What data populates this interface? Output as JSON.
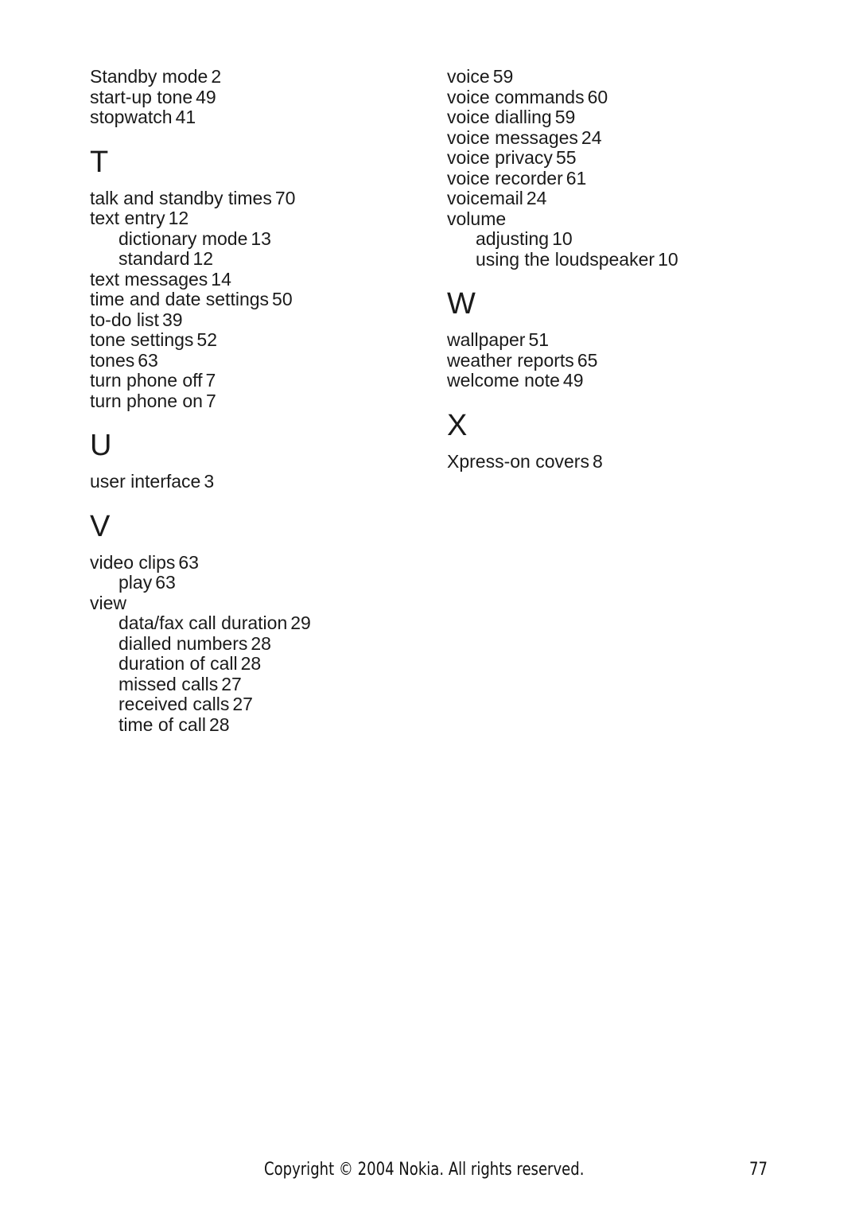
{
  "left_column": {
    "sections": [
      {
        "letter": "",
        "entries": [
          {
            "term": "Standby mode",
            "page": "2",
            "sub": false
          },
          {
            "term": "start-up tone",
            "page": "49",
            "sub": false
          },
          {
            "term": "stopwatch",
            "page": "41",
            "sub": false
          }
        ]
      },
      {
        "letter": "T",
        "entries": [
          {
            "term": "talk and standby times",
            "page": "70",
            "sub": false
          },
          {
            "term": "text entry",
            "page": "12",
            "sub": false
          },
          {
            "term": "dictionary mode",
            "page": "13",
            "sub": true
          },
          {
            "term": "standard",
            "page": "12",
            "sub": true
          },
          {
            "term": "text messages",
            "page": "14",
            "sub": false
          },
          {
            "term": "time and date settings",
            "page": "50",
            "sub": false
          },
          {
            "term": "to-do list",
            "page": "39",
            "sub": false
          },
          {
            "term": "tone settings",
            "page": "52",
            "sub": false
          },
          {
            "term": "tones",
            "page": "63",
            "sub": false
          },
          {
            "term": "turn phone off",
            "page": "7",
            "sub": false
          },
          {
            "term": "turn phone on",
            "page": "7",
            "sub": false
          }
        ]
      },
      {
        "letter": "U",
        "entries": [
          {
            "term": "user interface",
            "page": "3",
            "sub": false
          }
        ]
      },
      {
        "letter": "V",
        "entries": [
          {
            "term": "video clips",
            "page": "63",
            "sub": false
          },
          {
            "term": "play",
            "page": "63",
            "sub": true
          },
          {
            "term": "view",
            "page": "",
            "sub": false
          },
          {
            "term": "data/fax call duration",
            "page": "29",
            "sub": true
          },
          {
            "term": "dialled numbers",
            "page": "28",
            "sub": true
          },
          {
            "term": "duration of call",
            "page": "28",
            "sub": true
          },
          {
            "term": "missed calls",
            "page": "27",
            "sub": true
          },
          {
            "term": "received calls",
            "page": "27",
            "sub": true
          },
          {
            "term": "time of call",
            "page": "28",
            "sub": true
          }
        ]
      }
    ]
  },
  "right_column": {
    "sections": [
      {
        "letter": "",
        "entries": [
          {
            "term": "voice",
            "page": "59",
            "sub": false
          },
          {
            "term": "voice commands",
            "page": "60",
            "sub": false
          },
          {
            "term": "voice dialling",
            "page": "59",
            "sub": false
          },
          {
            "term": "voice messages",
            "page": "24",
            "sub": false
          },
          {
            "term": "voice privacy",
            "page": "55",
            "sub": false
          },
          {
            "term": "voice recorder",
            "page": "61",
            "sub": false
          },
          {
            "term": "voicemail",
            "page": "24",
            "sub": false
          },
          {
            "term": "volume",
            "page": "",
            "sub": false
          },
          {
            "term": "adjusting",
            "page": "10",
            "sub": true
          },
          {
            "term": "using the loudspeaker",
            "page": "10",
            "sub": true
          }
        ]
      },
      {
        "letter": "W",
        "entries": [
          {
            "term": "wallpaper",
            "page": "51",
            "sub": false
          },
          {
            "term": "weather reports",
            "page": "65",
            "sub": false
          },
          {
            "term": "welcome note",
            "page": "49",
            "sub": false
          }
        ]
      },
      {
        "letter": "X",
        "entries": [
          {
            "term": "Xpress-on covers",
            "page": "8",
            "sub": false
          }
        ]
      }
    ]
  },
  "footer": {
    "copyright": "Copyright © 2004 Nokia. All rights reserved.",
    "page_number": "77"
  }
}
